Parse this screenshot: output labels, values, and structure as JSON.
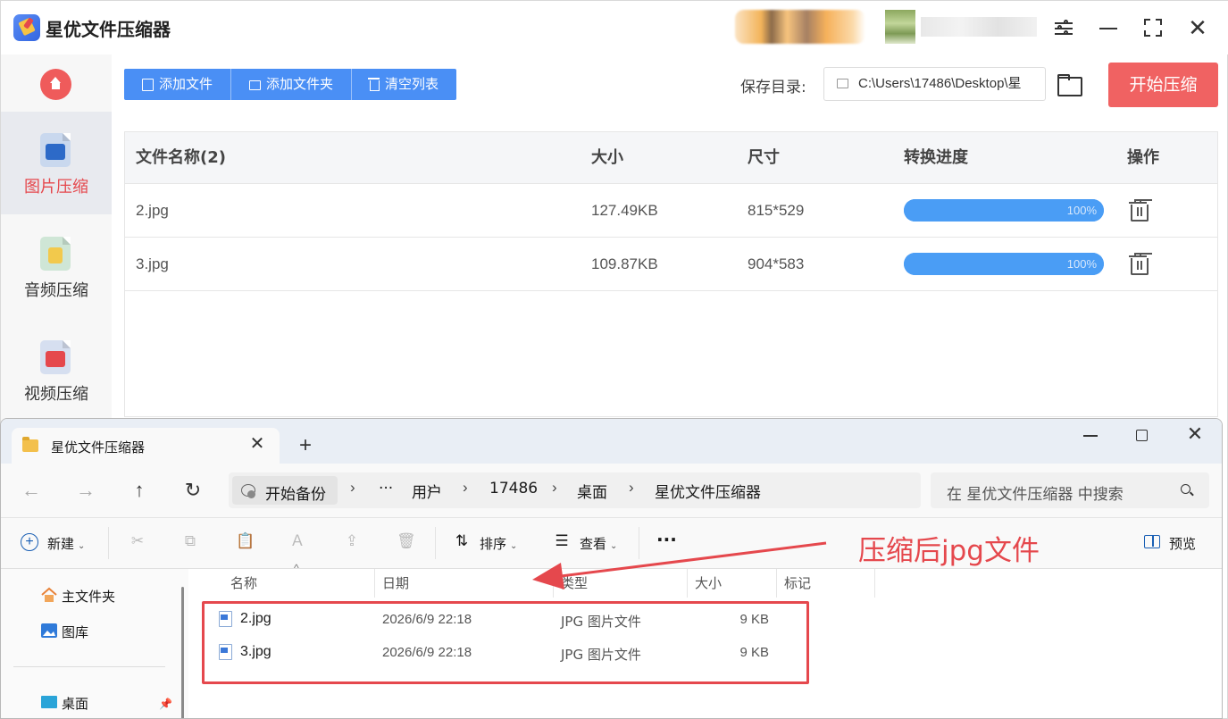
{
  "app": {
    "title": "星优文件压缩器",
    "sidebar": {
      "items": [
        {
          "label": "图片压缩",
          "active": true,
          "icon": "image-file-icon"
        },
        {
          "label": "音频压缩",
          "active": false,
          "icon": "audio-file-icon"
        },
        {
          "label": "视频压缩",
          "active": false,
          "icon": "video-file-icon"
        }
      ]
    },
    "toolbar": {
      "add_file": "添加文件",
      "add_folder": "添加文件夹",
      "clear_list": "清空列表",
      "save_dir_label": "保存目录:",
      "save_dir_value": "C:\\Users\\17486\\Desktop\\星",
      "start_label": "开始压缩"
    },
    "table": {
      "headers": {
        "name": "文件名称(2)",
        "size": "大小",
        "dims": "尺寸",
        "progress": "转换进度",
        "action": "操作"
      },
      "rows": [
        {
          "name": "2.jpg",
          "size": "127.49KB",
          "dims": "815*529",
          "progress": 1.0,
          "progress_text": "100%"
        },
        {
          "name": "3.jpg",
          "size": "109.87KB",
          "dims": "904*583",
          "progress": 1.0,
          "progress_text": "100%"
        }
      ]
    },
    "colors": {
      "accent_blue": "#4a8ff5",
      "accent_red": "#f06262",
      "progress": "#4a9df5"
    }
  },
  "explorer": {
    "tab_title": "星优文件压缩器",
    "breadcrumb": [
      "开始备份",
      "···",
      "用户",
      "17486",
      "桌面",
      "星优文件压缩器"
    ],
    "search_placeholder": "在 星优文件压缩器 中搜索",
    "commands": {
      "new": "新建",
      "sort": "排序",
      "view": "查看",
      "more": "···",
      "preview": "预览"
    },
    "annotation": "压缩后jpg文件",
    "nav": {
      "home": "主文件夹",
      "gallery": "图库",
      "desktop": "桌面"
    },
    "columns": {
      "name": "名称",
      "date": "日期",
      "type": "类型",
      "size": "大小",
      "tags": "标记"
    },
    "files": [
      {
        "name": "2.jpg",
        "date": "2026/6/9 22:18",
        "type": "JPG 图片文件",
        "size": "9 KB"
      },
      {
        "name": "3.jpg",
        "date": "2026/6/9 22:18",
        "type": "JPG 图片文件",
        "size": "9 KB"
      }
    ]
  }
}
